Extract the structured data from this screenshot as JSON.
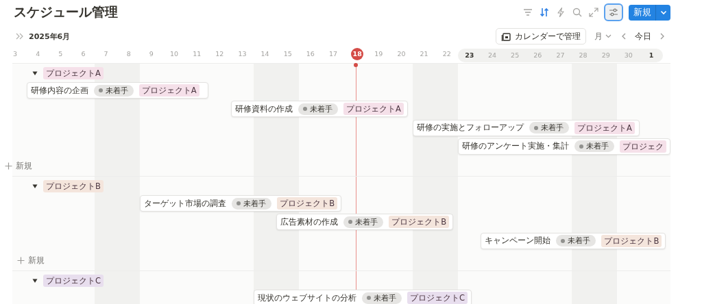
{
  "title": "スケジュール管理",
  "toolbar": [
    {
      "kind": "filter"
    },
    {
      "kind": "sort",
      "active": true
    },
    {
      "kind": "lightning"
    },
    {
      "kind": "search"
    },
    {
      "kind": "expand"
    },
    {
      "kind": "sliders",
      "active": true
    }
  ],
  "new_button": {
    "label": "新規"
  },
  "timeline": {
    "month": "2025年6月",
    "calendar_button": "カレンダーで管理",
    "scale": "月",
    "today_button": "今日",
    "days": [
      {
        "label": "3",
        "weekend": false,
        "today": false,
        "highlighted": false
      },
      {
        "label": "4",
        "weekend": false,
        "today": false,
        "highlighted": false
      },
      {
        "label": "5",
        "weekend": false,
        "today": false,
        "highlighted": false
      },
      {
        "label": "6",
        "weekend": false,
        "today": false,
        "highlighted": false
      },
      {
        "label": "7",
        "weekend": true,
        "today": false,
        "highlighted": false
      },
      {
        "label": "8",
        "weekend": true,
        "today": false,
        "highlighted": false
      },
      {
        "label": "9",
        "weekend": false,
        "today": false,
        "highlighted": false
      },
      {
        "label": "10",
        "weekend": false,
        "today": false,
        "highlighted": false
      },
      {
        "label": "11",
        "weekend": false,
        "today": false,
        "highlighted": false
      },
      {
        "label": "12",
        "weekend": false,
        "today": false,
        "highlighted": false
      },
      {
        "label": "13",
        "weekend": false,
        "today": false,
        "highlighted": false
      },
      {
        "label": "14",
        "weekend": true,
        "today": false,
        "highlighted": false
      },
      {
        "label": "15",
        "weekend": true,
        "today": false,
        "highlighted": false
      },
      {
        "label": "16",
        "weekend": false,
        "today": false,
        "highlighted": false
      },
      {
        "label": "17",
        "weekend": false,
        "today": false,
        "highlighted": false
      },
      {
        "label": "18",
        "weekend": false,
        "today": true,
        "highlighted": false
      },
      {
        "label": "19",
        "weekend": false,
        "today": false,
        "highlighted": false
      },
      {
        "label": "20",
        "weekend": false,
        "today": false,
        "highlighted": false
      },
      {
        "label": "21",
        "weekend": true,
        "today": false,
        "highlighted": false
      },
      {
        "label": "22",
        "weekend": true,
        "today": false,
        "highlighted": false
      },
      {
        "label": "23",
        "weekend": false,
        "today": false,
        "highlighted": true
      },
      {
        "label": "24",
        "weekend": false,
        "today": false,
        "highlighted": true
      },
      {
        "label": "25",
        "weekend": false,
        "today": false,
        "highlighted": true
      },
      {
        "label": "26",
        "weekend": false,
        "today": false,
        "highlighted": true
      },
      {
        "label": "27",
        "weekend": false,
        "today": false,
        "highlighted": true
      },
      {
        "label": "28",
        "weekend": true,
        "today": false,
        "highlighted": true
      },
      {
        "label": "29",
        "weekend": true,
        "today": false,
        "highlighted": true
      },
      {
        "label": "30",
        "weekend": false,
        "today": false,
        "highlighted": true
      },
      {
        "label": "1",
        "weekend": false,
        "today": false,
        "highlighted": true
      }
    ],
    "groups": [
      {
        "name": "プロジェクトA",
        "color": "#f5e0e9",
        "expanded": true,
        "new_label": "新規",
        "tasks": [
          {
            "name": "研修内容の企画",
            "status": "未着手",
            "tag": "プロジェクトA"
          },
          {
            "name": "研修資料の作成",
            "status": "未着手",
            "tag": "プロジェクトA"
          },
          {
            "name": "研修の実施とフォローアップ",
            "status": "未着手",
            "tag": "プロジェクトA"
          },
          {
            "name": "研修のアンケート実施・集計",
            "status": "未着手",
            "tag": "プロジェク"
          }
        ]
      },
      {
        "name": "プロジェクトB",
        "color": "#f4e5dc",
        "expanded": true,
        "new_label": "新規",
        "tasks": [
          {
            "name": "ターゲット市場の調査",
            "status": "未着手",
            "tag": "プロジェクトB"
          },
          {
            "name": "広告素材の作成",
            "status": "未着手",
            "tag": "プロジェクトB"
          },
          {
            "name": "キャンペーン開始",
            "status": "未着手",
            "tag": "プロジェクトB"
          }
        ]
      },
      {
        "name": "プロジェクトC",
        "color": "#e8deee",
        "expanded": true,
        "tasks": [
          {
            "name": "現状のウェブサイトの分析",
            "status": "未着手",
            "tag": "プロジェクトC"
          }
        ]
      }
    ]
  }
}
